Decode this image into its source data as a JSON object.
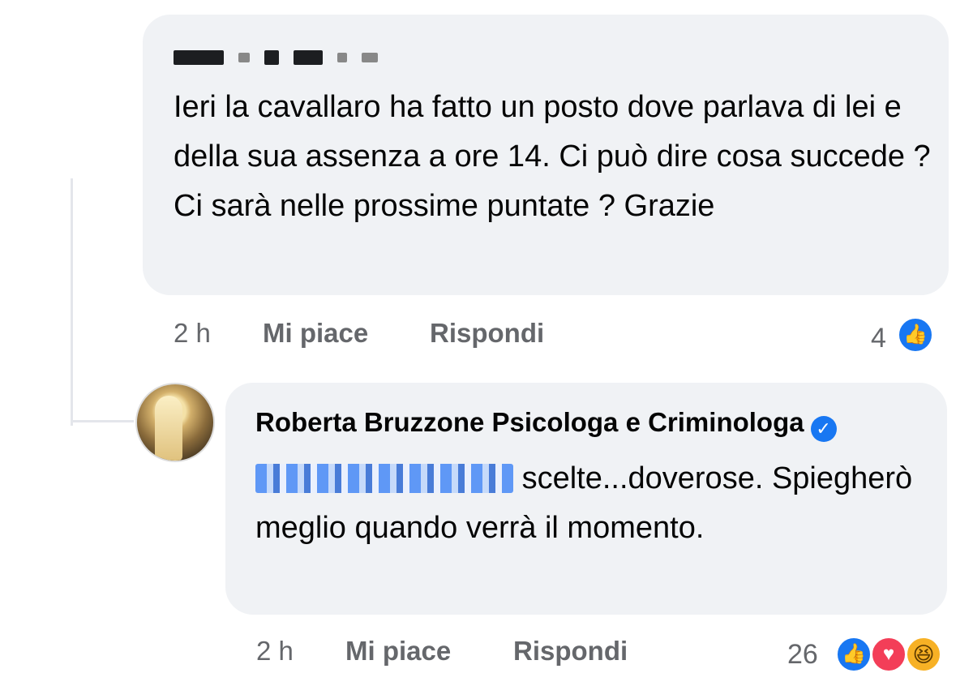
{
  "comment1": {
    "author_redacted": true,
    "text": "Ieri la cavallaro ha fatto un posto dove parlava di lei e della sua assenza a ore 14. Ci può  dire cosa succede ? Ci sarà nelle prossime puntate ? Grazie",
    "time": "2 h",
    "like_label": "Mi piace",
    "reply_label": "Rispondi",
    "reaction_count": "4",
    "reactions": [
      "like-icon"
    ]
  },
  "comment2": {
    "author": "Roberta Bruzzone Psicologa e Criminologa",
    "verified_icon": "verified-check-icon",
    "mention_redacted": true,
    "text_after_mention": "scelte...doverose. Spiegherò meglio quando verrà il momento.",
    "time": "2 h",
    "like_label": "Mi piace",
    "reply_label": "Rispondi",
    "reaction_count": "26",
    "reactions": [
      "like-icon",
      "love-icon",
      "haha-icon"
    ]
  },
  "colors": {
    "bubble_bg": "#f0f2f5",
    "meta_text": "#65676b",
    "like_blue": "#1877f2",
    "love_red": "#f33e58",
    "haha_yellow": "#f7b125"
  }
}
